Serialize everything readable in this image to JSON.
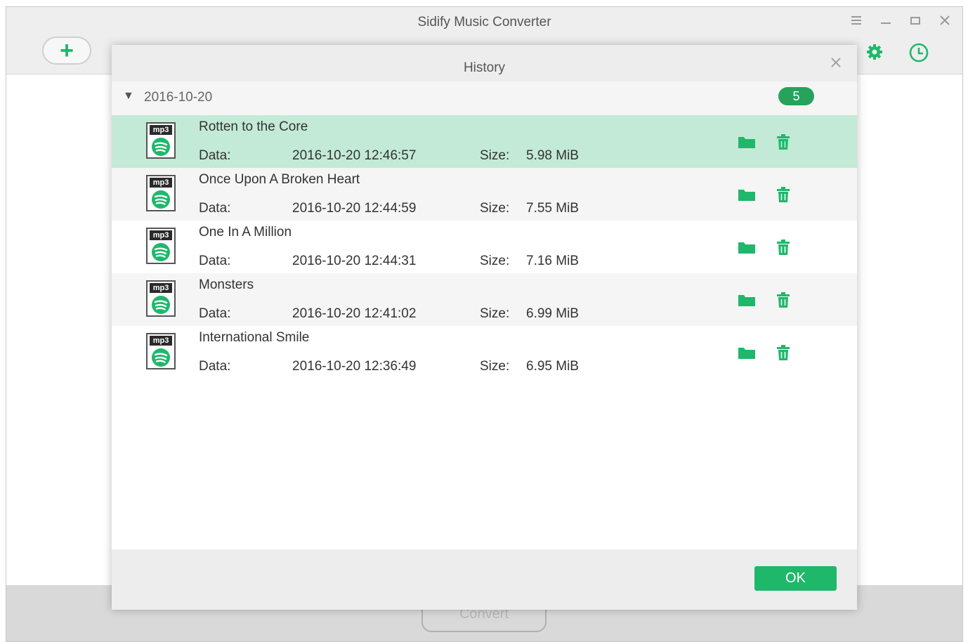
{
  "app": {
    "title": "Sidify Music Converter",
    "convert_label": "Convert",
    "window_controls": [
      "menu-icon",
      "minimize-icon",
      "maximize-icon",
      "close-icon"
    ],
    "accent_color": "#1fb86b"
  },
  "history": {
    "title": "History",
    "group": {
      "date": "2016-10-20",
      "count": "5",
      "expanded": true
    },
    "data_label": "Data:",
    "size_label": "Size:",
    "file_tag": "mp3",
    "ok_label": "OK",
    "items": [
      {
        "title": "Rotten to the Core",
        "date": "2016-10-20 12:46:57",
        "size": "5.98 MiB",
        "selected": true
      },
      {
        "title": "Once Upon A Broken Heart",
        "date": "2016-10-20 12:44:59",
        "size": "7.55 MiB",
        "selected": false
      },
      {
        "title": "One In A Million",
        "date": "2016-10-20 12:44:31",
        "size": "7.16 MiB",
        "selected": false
      },
      {
        "title": "Monsters",
        "date": "2016-10-20 12:41:02",
        "size": "6.99 MiB",
        "selected": false
      },
      {
        "title": "International Smile",
        "date": "2016-10-20 12:36:49",
        "size": "6.95 MiB",
        "selected": false
      }
    ]
  }
}
